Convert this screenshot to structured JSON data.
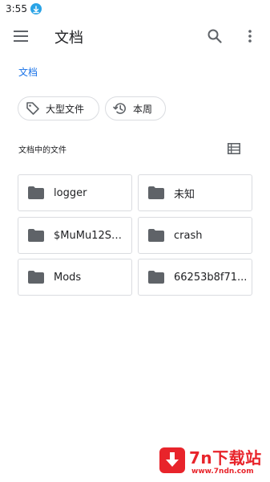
{
  "status_bar": {
    "time": "3:55"
  },
  "app_bar": {
    "title": "文档"
  },
  "breadcrumb": {
    "label": "文档"
  },
  "chips": [
    {
      "label": "大型文件",
      "icon": "tag-icon"
    },
    {
      "label": "本周",
      "icon": "history-icon"
    }
  ],
  "section": {
    "label": "文档中的文件"
  },
  "folders": [
    {
      "name": "logger"
    },
    {
      "name": "未知"
    },
    {
      "name": "$MuMu12Sh..."
    },
    {
      "name": "crash"
    },
    {
      "name": "Mods"
    },
    {
      "name": "66253b8f71..."
    }
  ],
  "watermark": {
    "title": "7n下载站",
    "url": "www.7ndn.com"
  },
  "colors": {
    "accent": "#1a73e8",
    "icon_gray": "#5f6368",
    "watermark_red": "#e8242b",
    "download_blue": "#29a3e6"
  }
}
